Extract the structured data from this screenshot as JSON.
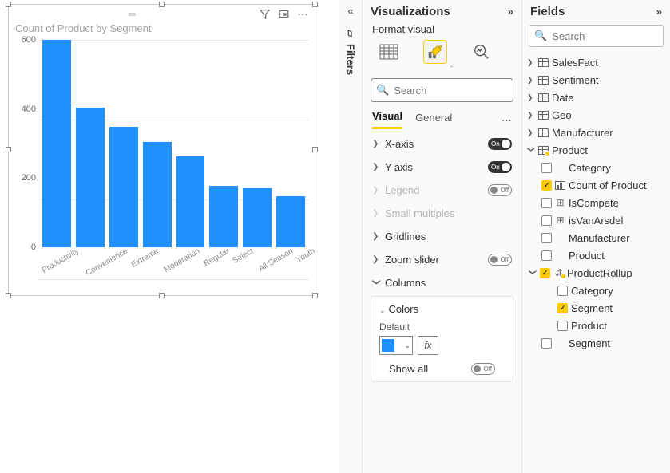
{
  "chart_data": {
    "type": "bar",
    "title": "Count of Product by Segment",
    "xlabel": "",
    "ylabel": "",
    "ylim": [
      0,
      600
    ],
    "yticks": [
      0,
      200,
      400,
      600
    ],
    "categories": [
      "Productivity",
      "Convenience",
      "Extreme",
      "Moderation",
      "Regular",
      "Select",
      "All Season",
      "Youth"
    ],
    "values": [
      600,
      405,
      348,
      305,
      262,
      178,
      170,
      148
    ]
  },
  "panes": {
    "visualizations": {
      "title": "Visualizations",
      "subtitle": "Format visual",
      "search_placeholder": "Search",
      "tabs": {
        "visual": "Visual",
        "general": "General"
      },
      "props": {
        "xaxis": {
          "label": "X-axis",
          "state": "On"
        },
        "yaxis": {
          "label": "Y-axis",
          "state": "On"
        },
        "legend": {
          "label": "Legend",
          "state": "Off"
        },
        "smallm": {
          "label": "Small multiples"
        },
        "grid": {
          "label": "Gridlines"
        },
        "zoom": {
          "label": "Zoom slider",
          "state": "Off"
        },
        "columns": {
          "label": "Columns"
        }
      },
      "colors_card": {
        "header": "Colors",
        "default_label": "Default",
        "fx": "fx",
        "showall_label": "Show all",
        "showall_state": "Off",
        "swatch_hex": "#1e90ff"
      }
    },
    "fields": {
      "title": "Fields",
      "search_placeholder": "Search",
      "tables": {
        "salesfact": "SalesFact",
        "sentiment": "Sentiment",
        "date": "Date",
        "geo": "Geo",
        "manufacturer": "Manufacturer",
        "product": "Product"
      },
      "product_fields": {
        "category": "Category",
        "count": "Count of Product",
        "iscompete": "IsCompete",
        "isvanarsdel": "isVanArsdel",
        "manufacturer": "Manufacturer",
        "product": "Product",
        "rollup": "ProductRollup",
        "rollup_children": {
          "category": "Category",
          "segment": "Segment",
          "product": "Product"
        },
        "segment": "Segment"
      }
    },
    "filters_tab": "Filters"
  }
}
